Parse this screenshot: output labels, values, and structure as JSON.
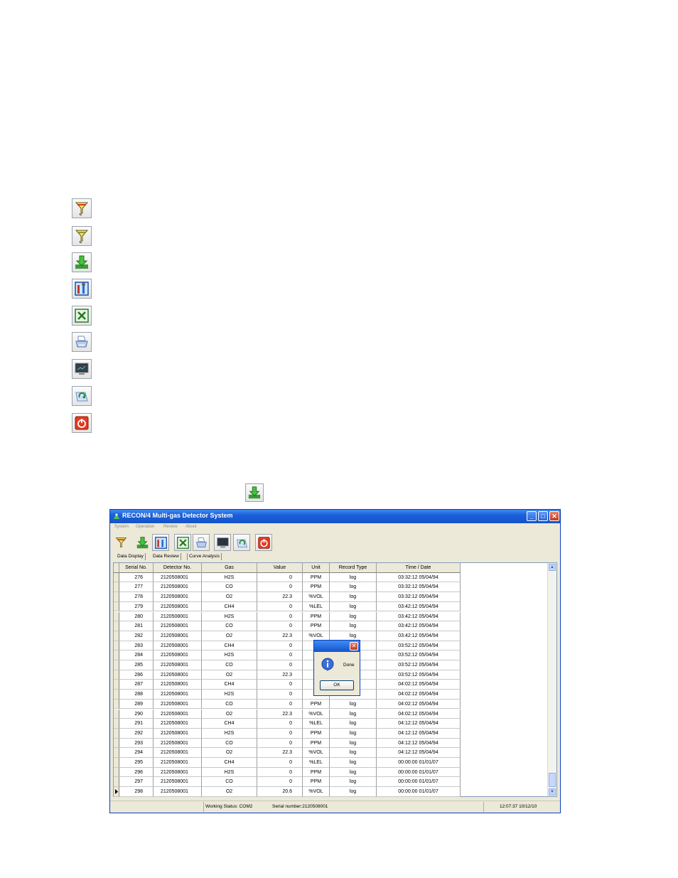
{
  "legend_icons": [
    "filter-icon",
    "filter-icon-2",
    "download-icon",
    "settings-tools-icon",
    "excel-icon",
    "printer-icon",
    "monitor-icon",
    "refresh-icon",
    "power-icon"
  ],
  "inline_icon": "download-icon",
  "window": {
    "title": "RECON/4 Multi-gas Detector System",
    "menu": [
      "System",
      "Operation",
      "Review",
      "About"
    ],
    "tabs": [
      "Data Display",
      "Data Review",
      "Curve Analysis"
    ],
    "columns": [
      "Serial No.",
      "Detector No.",
      "Gas",
      "Value",
      "Unit",
      "Record Type",
      "Time / Date"
    ],
    "rows": [
      [
        "276",
        "2120508001",
        "H2S",
        "0",
        "PPM",
        "log",
        "03:32:12 05/04/94"
      ],
      [
        "277",
        "2120508001",
        "CO",
        "0",
        "PPM",
        "log",
        "03:32:12 05/04/94"
      ],
      [
        "278",
        "2120508001",
        "O2",
        "22.3",
        "%VOL",
        "log",
        "03:32:12 05/04/94"
      ],
      [
        "279",
        "2120508001",
        "CH4",
        "0",
        "%LEL",
        "log",
        "03:42:12 05/04/94"
      ],
      [
        "280",
        "2120508001",
        "H2S",
        "0",
        "PPM",
        "log",
        "03:42:12 05/04/94"
      ],
      [
        "281",
        "2120508001",
        "CO",
        "0",
        "PPM",
        "log",
        "03:42:12 05/04/94"
      ],
      [
        "282",
        "2120508001",
        "O2",
        "22.3",
        "%VOL",
        "log",
        "03:42:12 05/04/94"
      ],
      [
        "283",
        "2120508001",
        "CH4",
        "0",
        "%",
        "",
        "03:52:12 05/04/94"
      ],
      [
        "284",
        "2120508001",
        "H2S",
        "0",
        "F",
        "",
        "03:52:12 05/04/94"
      ],
      [
        "285",
        "2120508001",
        "CO",
        "0",
        "F",
        "",
        "03:52:12 05/04/94"
      ],
      [
        "286",
        "2120508001",
        "O2",
        "22.3",
        "%",
        "",
        "03:52:12 05/04/94"
      ],
      [
        "287",
        "2120508001",
        "CH4",
        "0",
        "%",
        "",
        "04:02:12 05/04/94"
      ],
      [
        "288",
        "2120508001",
        "H2S",
        "0",
        "F",
        "",
        "04:02:12 05/04/94"
      ],
      [
        "289",
        "2120508001",
        "CO",
        "0",
        "PPM",
        "log",
        "04:02:12 05/04/94"
      ],
      [
        "290",
        "2120508001",
        "O2",
        "22.3",
        "%VOL",
        "log",
        "04:02:12 05/04/94"
      ],
      [
        "291",
        "2120508001",
        "CH4",
        "0",
        "%LEL",
        "log",
        "04:12:12 05/04/94"
      ],
      [
        "292",
        "2120508001",
        "H2S",
        "0",
        "PPM",
        "log",
        "04:12:12 05/04/94"
      ],
      [
        "293",
        "2120508001",
        "CO",
        "0",
        "PPM",
        "log",
        "04:12:12 05/04/94"
      ],
      [
        "294",
        "2120508001",
        "O2",
        "22.3",
        "%VOL",
        "log",
        "04:12:12 05/04/94"
      ],
      [
        "295",
        "2120508001",
        "CH4",
        "0",
        "%LEL",
        "log",
        "00:00:00 01/01/07"
      ],
      [
        "296",
        "2120508001",
        "H2S",
        "0",
        "PPM",
        "log",
        "00:00:00 01/01/07"
      ],
      [
        "297",
        "2120508001",
        "CO",
        "0",
        "PPM",
        "log",
        "00:00:00 01/01/07"
      ],
      [
        "298",
        "2120508001",
        "O2",
        "20.6",
        "%VOL",
        "log",
        "00:00:00 01/01/07"
      ]
    ],
    "status": {
      "working_status": "Working Status:   COM2",
      "serial_number": "Serial number:2120508001",
      "clock": "12:07:37 10/12/10"
    }
  },
  "dialog": {
    "message": "Done",
    "ok_label": "OK"
  }
}
